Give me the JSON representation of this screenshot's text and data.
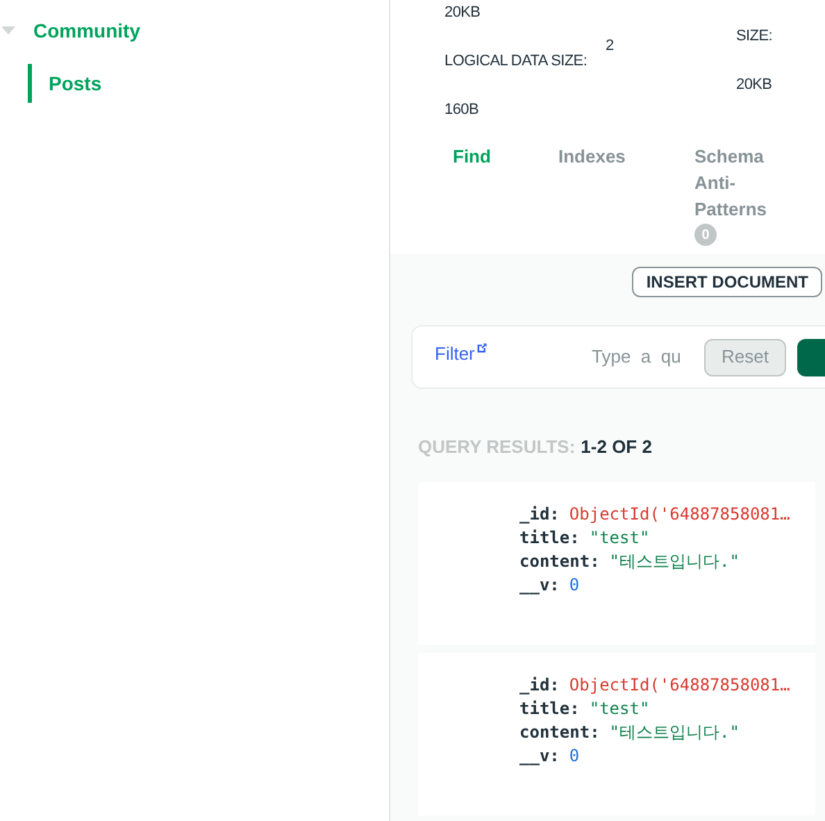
{
  "sidebar": {
    "group": {
      "label": "Community",
      "expanded": true
    },
    "items": [
      {
        "label": "Posts",
        "selected": true
      }
    ]
  },
  "stats": [
    [
      "20KB",
      "LOGICAL DATA SIZE:",
      "160B"
    ],
    [
      "2"
    ],
    [
      "SIZE:",
      "20KB"
    ]
  ],
  "tabs": [
    {
      "label": "Find",
      "selected": true
    },
    {
      "label": "Indexes",
      "selected": false
    },
    {
      "label": "Schema Anti-Patterns",
      "selected": false,
      "badge": "0"
    }
  ],
  "insert_button": "INSERT DOCUMENT",
  "filter": {
    "label": "Filter",
    "placeholder": "Type  a  qu",
    "reset": "Reset"
  },
  "results": {
    "label": "QUERY RESULTS:",
    "count": "1-2 OF 2"
  },
  "documents": [
    {
      "fields": [
        {
          "key": "_id:",
          "value": "ObjectId('64887858081…",
          "kind": "objectid"
        },
        {
          "key": "title:",
          "value": "\"test\"",
          "kind": "string"
        },
        {
          "key": "content:",
          "value": "\"테스트입니다.\"",
          "kind": "string"
        },
        {
          "key": "__v:",
          "value": "0",
          "kind": "number"
        }
      ]
    },
    {
      "fields": [
        {
          "key": "_id:",
          "value": "ObjectId('64887858081…",
          "kind": "objectid"
        },
        {
          "key": "title:",
          "value": "\"test\"",
          "kind": "string"
        },
        {
          "key": "content:",
          "value": "\"테스트입니다.\"",
          "kind": "string"
        },
        {
          "key": "__v:",
          "value": "0",
          "kind": "number"
        }
      ]
    }
  ]
}
